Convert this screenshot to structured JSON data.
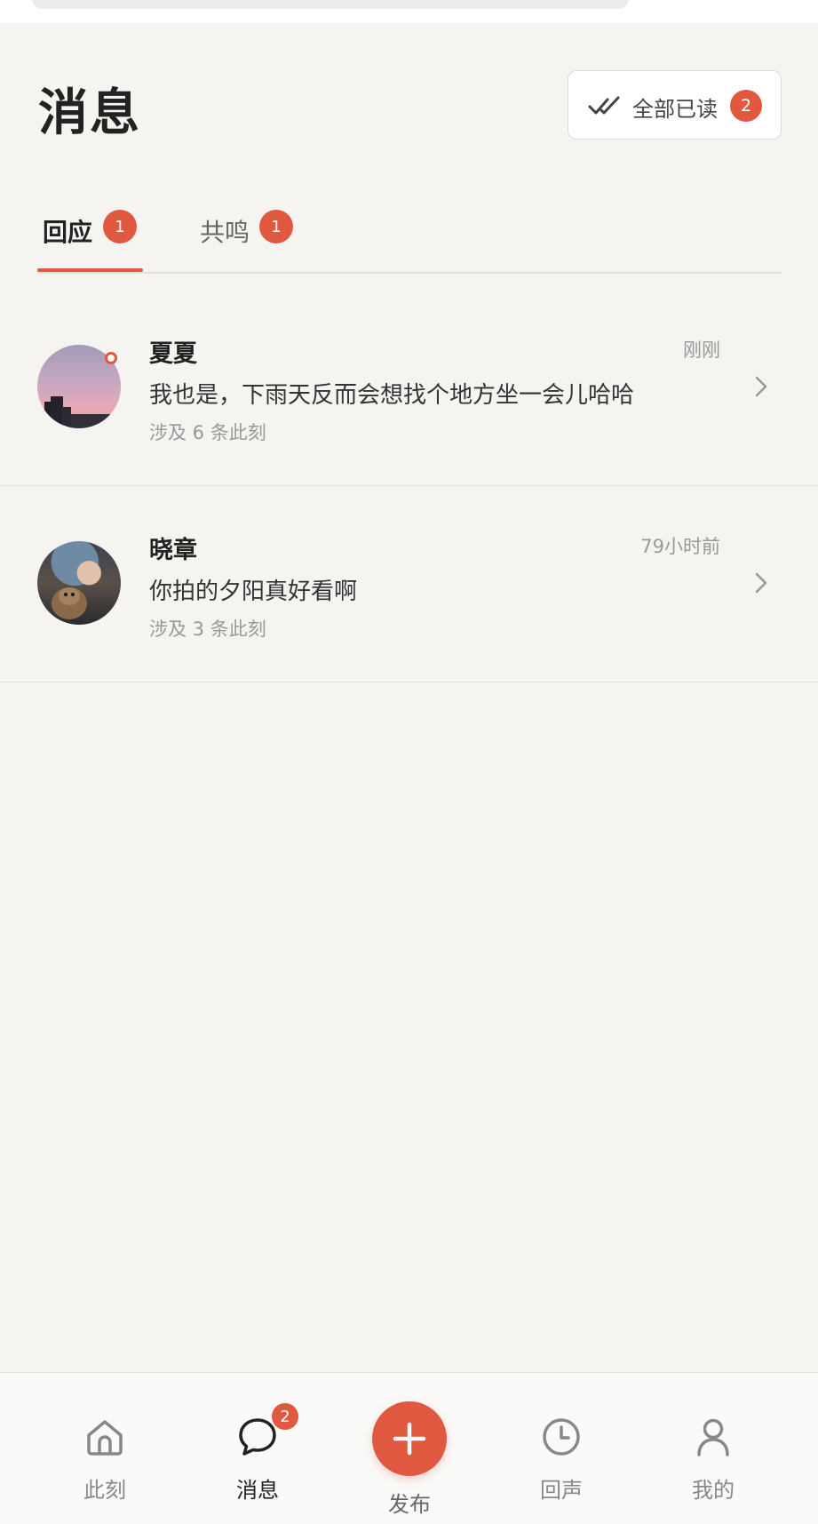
{
  "header": {
    "title": "消息",
    "mark_all_label": "全部已读",
    "mark_all_count": "2"
  },
  "tabs": [
    {
      "label": "回应",
      "count": "1",
      "active": true
    },
    {
      "label": "共鸣",
      "count": "1",
      "active": false
    }
  ],
  "messages": [
    {
      "sender": "夏夏",
      "time": "刚刚",
      "preview": "我也是，下雨天反而会想找个地方坐一会儿哈哈",
      "meta": "涉及 6 条此刻",
      "unread": true
    },
    {
      "sender": "晓章",
      "time": "79小时前",
      "preview": "你拍的夕阳真好看啊",
      "meta": "涉及 3 条此刻",
      "unread": false
    }
  ],
  "bottom_nav": {
    "home": "此刻",
    "messages": "消息",
    "messages_badge": "2",
    "publish": "发布",
    "echo": "回声",
    "mine": "我的"
  },
  "colors": {
    "accent": "#e0583f",
    "background": "#f5f4f0"
  }
}
